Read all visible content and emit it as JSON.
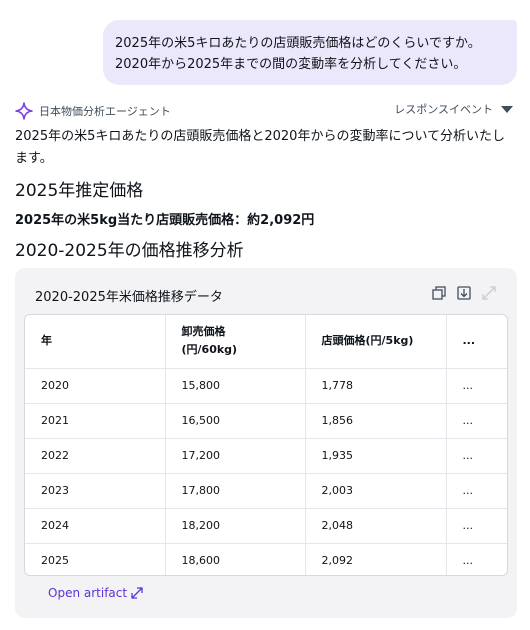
{
  "user_message": {
    "line1": "2025年の米5キロあたりの店頭販売価格はどのくらいですか。",
    "line2": "2020年から2025年までの間の変動率を分析してください。"
  },
  "agent": {
    "name": "日本物価分析エージェント",
    "response_events_label": "レスポンスイベント"
  },
  "response": {
    "intro": "2025年の米5キロあたりの店頭販売価格と2020年からの変動率について分析いたします。",
    "heading_estimate": "2025年推定価格",
    "strong_line": "2025年の米5kg当たり店頭販売価格：約2,092円",
    "heading_trend": "2020-2025年の価格推移分析"
  },
  "artifact": {
    "title": "2020-2025年米価格推移データ",
    "open_label": "Open artifact",
    "columns": {
      "year": "年",
      "wholesale_line1": "卸売価格",
      "wholesale_line2": "(円/60kg)",
      "retail": "店頭価格(円/5kg)",
      "more": "..."
    },
    "rows": [
      {
        "year": "2020",
        "wholesale": "15,800",
        "retail": "1,778",
        "more": "..."
      },
      {
        "year": "2021",
        "wholesale": "16,500",
        "retail": "1,856",
        "more": "..."
      },
      {
        "year": "2022",
        "wholesale": "17,200",
        "retail": "1,935",
        "more": "..."
      },
      {
        "year": "2023",
        "wholesale": "17,800",
        "retail": "2,003",
        "more": "..."
      },
      {
        "year": "2024",
        "wholesale": "18,200",
        "retail": "2,048",
        "more": "..."
      },
      {
        "year": "2025",
        "wholesale": "18,600",
        "retail": "2,092",
        "more": "..."
      }
    ]
  },
  "colors": {
    "user_bubble": "#ece8fb",
    "agent_icon": "#7b3fe4",
    "link": "#5b33d6"
  },
  "icons": [
    "sparkle-icon",
    "caret-down-icon",
    "copy-icon",
    "download-icon",
    "expand-icon",
    "external-link-icon"
  ]
}
